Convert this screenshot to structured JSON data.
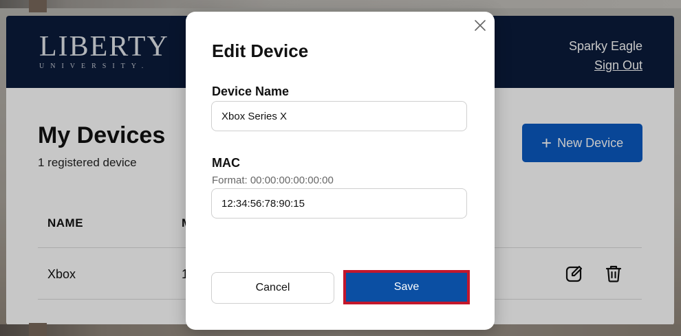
{
  "header": {
    "logo_word": "LIBERTY",
    "logo_sub": "UNIVERSITY.",
    "user_name": "Sparky Eagle",
    "sign_out_label": "Sign Out"
  },
  "page": {
    "title": "My Devices",
    "subtitle": "1 registered device",
    "new_device_label": "New Device"
  },
  "table": {
    "columns": [
      "NAME",
      "M"
    ],
    "rows": [
      {
        "name": "Xbox",
        "mac": "1"
      }
    ]
  },
  "modal": {
    "title": "Edit Device",
    "device_name_label": "Device Name",
    "device_name_value": "Xbox Series X",
    "mac_label": "MAC",
    "mac_hint": "Format: 00:00:00:00:00:00",
    "mac_value": "12:34:56:78:90:15",
    "cancel_label": "Cancel",
    "save_label": "Save"
  },
  "icons": {
    "close": "close-icon",
    "plus": "plus-icon",
    "edit": "edit-icon",
    "trash": "trash-icon"
  },
  "colors": {
    "header_bg": "#0b1c3b",
    "primary": "#0b5ac2",
    "save_bg": "#0b4fa3",
    "save_border": "#c3172c"
  }
}
